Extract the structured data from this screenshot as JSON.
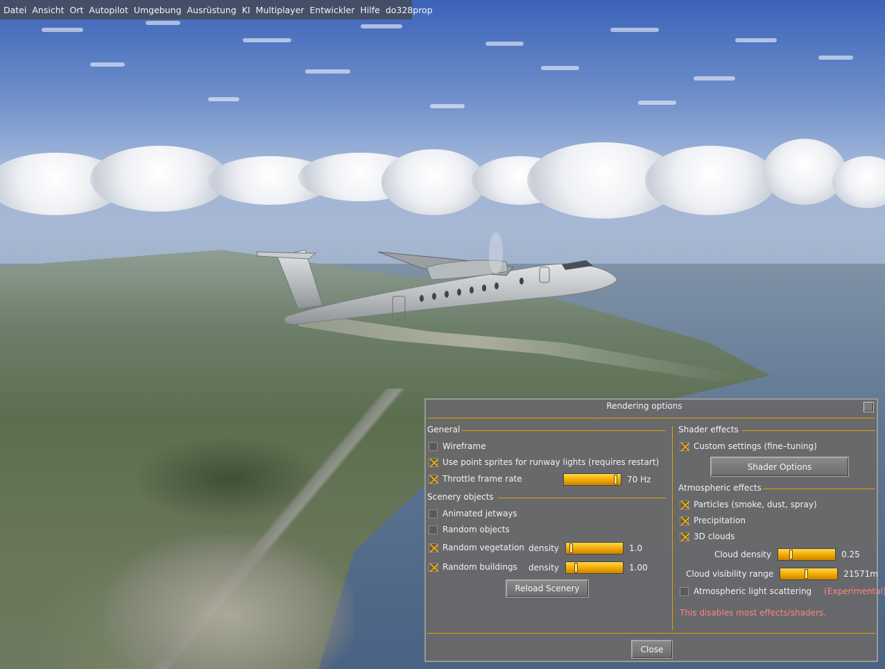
{
  "menubar": {
    "items": [
      "Datei",
      "Ansicht",
      "Ort",
      "Autopilot",
      "Umgebung",
      "Ausrüstung",
      "KI",
      "Multiplayer",
      "Entwickler",
      "Hilfe",
      "do328prop"
    ]
  },
  "dialog": {
    "title": "Rendering options",
    "general": {
      "heading": "General",
      "wireframe": {
        "label": "Wireframe",
        "checked": false
      },
      "point_sprites": {
        "label": "Use point sprites for runway lights (requires restart)",
        "checked": true
      },
      "throttle": {
        "label": "Throttle frame rate",
        "checked": true,
        "slider_fraction": 0.95,
        "value": "70 Hz"
      }
    },
    "scenery": {
      "heading": "Scenery objects",
      "jetways": {
        "label": "Animated jetways",
        "checked": false
      },
      "random_objects": {
        "label": "Random objects",
        "checked": false
      },
      "vegetation": {
        "label": "Random vegetation",
        "checked": true,
        "density_label": "density",
        "slider_fraction": 0.05,
        "value": "1.0"
      },
      "buildings": {
        "label": "Random buildings",
        "checked": true,
        "density_label": "density",
        "slider_fraction": 0.15,
        "value": "1.00"
      },
      "reload_button": "Reload Scenery"
    },
    "shader": {
      "heading": "Shader effects",
      "custom": {
        "label": "Custom settings (fine–tuning)",
        "checked": true
      },
      "options_button": "Shader Options"
    },
    "atmospheric": {
      "heading": "Atmospheric effects",
      "particles": {
        "label": "Particles (smoke, dust, spray)",
        "checked": true
      },
      "precipitation": {
        "label": "Precipitation",
        "checked": true
      },
      "clouds3d": {
        "label": "3D clouds",
        "checked": true
      },
      "cloud_density": {
        "label": "Cloud density",
        "slider_fraction": 0.2,
        "value": "0.25"
      },
      "cloud_visibility": {
        "label": "Cloud visibility range",
        "slider_fraction": 0.45,
        "value": "21571m"
      },
      "scattering": {
        "label": "Atmospheric light scattering",
        "checked": false,
        "note": "(Experimental)"
      },
      "warning": "This disables most effects/shaders."
    },
    "close_button": "Close"
  },
  "colors": {
    "accent": "#e6a200",
    "warning_text": "#ff8484",
    "dialog_bg": "#686868"
  }
}
